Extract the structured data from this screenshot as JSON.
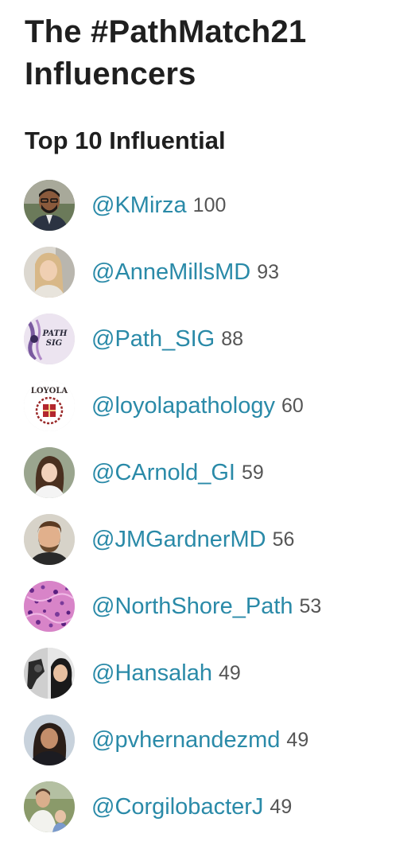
{
  "header": {
    "title_line1": "The #PathMatch21",
    "title_line2": "Influencers",
    "subtitle": "Top 10 Influential"
  },
  "influencers": [
    {
      "handle": "@KMirza",
      "score": "100"
    },
    {
      "handle": "@AnneMillsMD",
      "score": "93"
    },
    {
      "handle": "@Path_SIG",
      "score": "88",
      "avatar_text": "PATH SIG"
    },
    {
      "handle": "@loyolapathology",
      "score": "60",
      "avatar_text": "LOYOLA"
    },
    {
      "handle": "@CArnold_GI",
      "score": "59"
    },
    {
      "handle": "@JMGardnerMD",
      "score": "56"
    },
    {
      "handle": "@NorthShore_Path",
      "score": "53"
    },
    {
      "handle": "@Hansalah",
      "score": "49"
    },
    {
      "handle": "@pvhernandezmd",
      "score": "49"
    },
    {
      "handle": "@CorgilobacterJ",
      "score": "49"
    }
  ],
  "colors": {
    "handle": "#2a8aa8",
    "score": "#555555",
    "heading": "#1f1f1f"
  }
}
